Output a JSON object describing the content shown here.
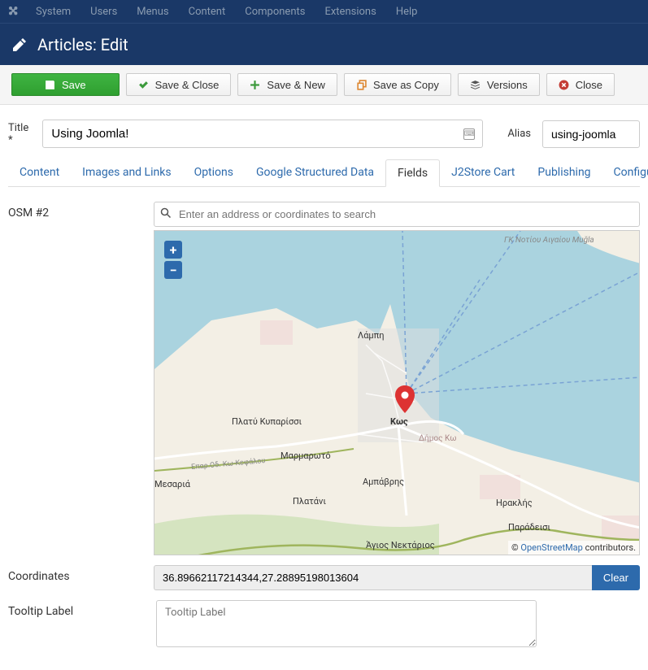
{
  "top_nav": [
    "System",
    "Users",
    "Menus",
    "Content",
    "Components",
    "Extensions",
    "Help"
  ],
  "header": {
    "title": "Articles: Edit"
  },
  "toolbar": {
    "save": "Save",
    "save_close": "Save & Close",
    "save_new": "Save & New",
    "save_copy": "Save as Copy",
    "versions": "Versions",
    "close": "Close"
  },
  "form": {
    "title_label": "Title *",
    "title_value": "Using Joomla!",
    "alias_label": "Alias",
    "alias_value": "using-joomla"
  },
  "tabs": [
    "Content",
    "Images and Links",
    "Options",
    "Google Structured Data",
    "Fields",
    "J2Store Cart",
    "Publishing",
    "Configure Ed"
  ],
  "tabs_active_index": 4,
  "fields": {
    "osm_label": "OSM #2",
    "search_placeholder": "Enter an address or coordinates to search",
    "coords_label": "Coordinates",
    "coords_value": "36.89662117214344,27.28895198013604",
    "clear_label": "Clear",
    "tooltip_label": "Tooltip Label",
    "tooltip_placeholder": "Tooltip Label"
  },
  "map": {
    "zoom_in": "+",
    "zoom_out": "−",
    "attribution_prefix": "© ",
    "attribution_link": "OpenStreetMap",
    "attribution_suffix": " contributors.",
    "labels": {
      "lampi": "Λάμπη",
      "platy_kyparissi": "Πλατύ Κυπαρίσσι",
      "marmaroto": "Μαρμαρωτό",
      "platani": "Πλατάνι",
      "amparis": "Αμπάβρης",
      "mesaria": "Μεσαριά",
      "kos": "Κως",
      "dimos_ko": "Δήμος Κω",
      "iraklis": "Ηρακλής",
      "paradeisi": "Παράδεισι",
      "agios_nektarios": "Άγιος Νεκτάριος",
      "epar_road": "Eπαρ.Oδ. Κω-Κεφάλου",
      "turkish_coast": "ΓΚ Nοτίου Αιγαίου   Muğla"
    }
  }
}
